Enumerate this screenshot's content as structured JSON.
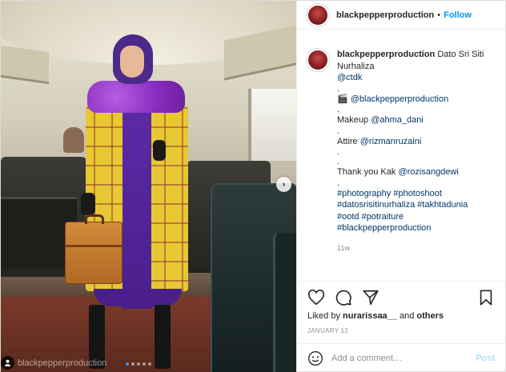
{
  "post": {
    "username": "blackpepperproduction",
    "follow_label": "Follow",
    "separator": "•",
    "watermark": "blackpepperproduction",
    "nav_next_glyph": "›",
    "carousel": {
      "count": 5,
      "active_index": 0
    }
  },
  "caption": {
    "username": "blackpepperproduction",
    "line1": "Dato Sri Siti Nurhaliza",
    "mention_ctdk": "@ctdk",
    "dot": ".",
    "camera_glyph": "🎬",
    "mention_bp": "@blackpepperproduction",
    "makeup_label": "Makeup ",
    "mention_makeup": "@ahma_dani",
    "attire_label": "Attire ",
    "mention_attire": "@rizmanruzaini",
    "thanks_label": "Thank you Kak ",
    "mention_thanks": "@rozisangdewi",
    "hashtags_line1": "#photography #photoshoot",
    "hashtags_line2": "#datosrisitinurhaliza #takhtadunia",
    "hashtags_line3": "#ootd #potraiture",
    "hashtags_line4": "#blackpepperproduction",
    "time_ago": "11w"
  },
  "engagement": {
    "liked_by_prefix": "Liked by ",
    "liked_by_user": "nurarissaa__",
    "liked_by_suffix": " and ",
    "others": "others",
    "date": "JANUARY 12"
  },
  "comment": {
    "placeholder": "Add a comment…",
    "post_label": "Post"
  }
}
